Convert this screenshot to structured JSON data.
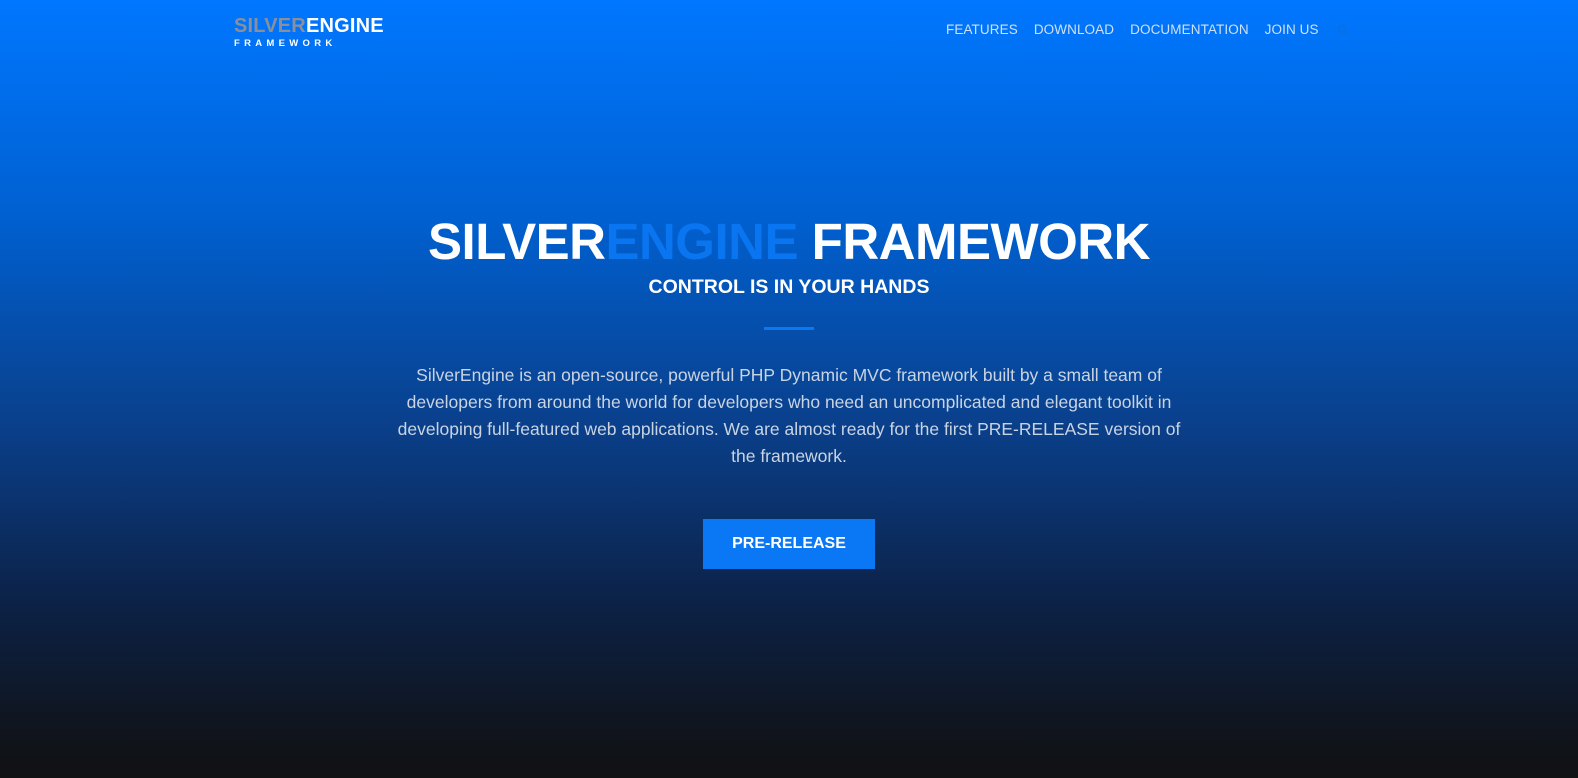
{
  "header": {
    "logo": {
      "silver": "SILVER",
      "engine": "ENGINE",
      "sub": "FRAMEWORK"
    },
    "nav": [
      {
        "label": "FEATURES"
      },
      {
        "label": "DOWNLOAD"
      },
      {
        "label": "DOCUMENTATION"
      },
      {
        "label": "JOIN US"
      }
    ],
    "search_icon": "search-icon"
  },
  "hero": {
    "title_silver": "SILVER",
    "title_engine": "ENGINE",
    "title_framework": "FRAMEWORK",
    "subtitle": "CONTROL IS IN YOUR HANDS",
    "description": "SilverEngine is an open-source, powerful PHP Dynamic MVC framework built by a small team of developers from around the world for developers who need an uncomplicated and elegant toolkit in developing full-featured web applications. We are almost ready for the first PRE-RELEASE version of the framework.",
    "button_label": "PRE-RELEASE"
  },
  "colors": {
    "accent": "#0a78f5",
    "gradient_top": "#0077ff",
    "gradient_bottom": "#111214",
    "logo_silver": "#8a8f99"
  }
}
